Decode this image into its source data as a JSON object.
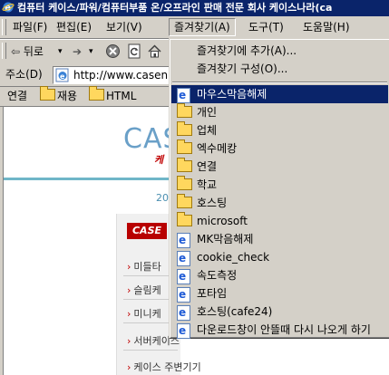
{
  "window": {
    "title": "컴퓨터 케이스/파워/컴퓨터부품 온/오프라인 판매 전문 회사 케이스나라(ca"
  },
  "menubar": {
    "items": [
      {
        "label": "파일(F)",
        "key": "F"
      },
      {
        "label": "편집(E)",
        "key": "E"
      },
      {
        "label": "보기(V)",
        "key": "V"
      },
      {
        "label": "즐겨찾기(A)",
        "key": "A"
      },
      {
        "label": "도구(T)",
        "key": "T"
      },
      {
        "label": "도움말(H)",
        "key": "H"
      }
    ]
  },
  "toolbar": {
    "back_label": "뒤로",
    "back_arrow": "⇦",
    "dropdown_arrow": "▾",
    "forward_arrow": "➔"
  },
  "address": {
    "label": "주소(D)",
    "url": "http://www.casen"
  },
  "links": {
    "label": "연결",
    "items": [
      "재용",
      "HTML"
    ]
  },
  "favorites_menu": {
    "add_label": "즐겨찾기에 추가(A)...",
    "organize_label": "즐겨찾기 구성(O)...",
    "items": [
      {
        "label": "마우스막음해제",
        "icon": "page-icon",
        "selected": true
      },
      {
        "label": "개인",
        "icon": "folder-icon"
      },
      {
        "label": "업체",
        "icon": "folder-icon"
      },
      {
        "label": "엑수메캉",
        "icon": "folder-icon"
      },
      {
        "label": "연결",
        "icon": "folder-icon"
      },
      {
        "label": "학교",
        "icon": "folder-icon"
      },
      {
        "label": "호스팅",
        "icon": "folder-icon"
      },
      {
        "label": "microsoft",
        "icon": "folder-icon"
      },
      {
        "label": "MK막음해제",
        "icon": "page-icon"
      },
      {
        "label": "cookie_check",
        "icon": "page-icon"
      },
      {
        "label": "속도측정",
        "icon": "page-icon"
      },
      {
        "label": "포타임",
        "icon": "page-icon"
      },
      {
        "label": "호스팅(cafe24)",
        "icon": "page-icon"
      },
      {
        "label": "다운로드창이 안뜰때 다시 나오게 하기",
        "icon": "page-icon"
      }
    ]
  },
  "page": {
    "logo_text": "CAS",
    "logo_sub": "케",
    "date_fragment": "20",
    "case_badge": "CASE",
    "side_links": [
      "미들타",
      "슬림케",
      "미니케",
      "서버케이스",
      "케이스 주변기기"
    ]
  },
  "colors": {
    "titlebar": "#0a246a",
    "menu_face": "#d4d0c8",
    "selection": "#0a246a",
    "logo": "#6aa0c8",
    "accent_red": "#b80000"
  }
}
